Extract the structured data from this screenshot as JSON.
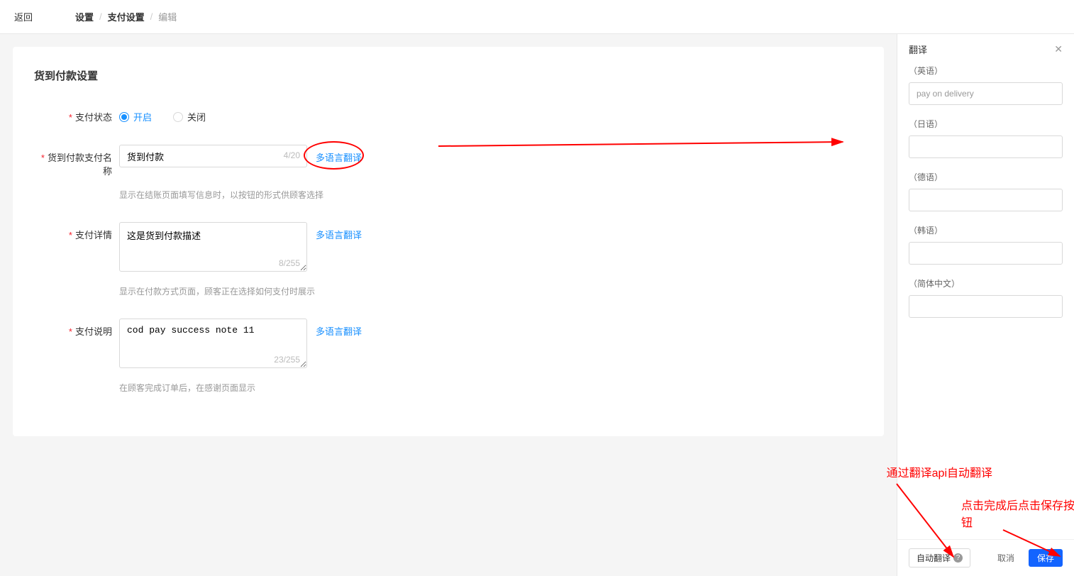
{
  "header": {
    "back": "返回",
    "breadcrumb": [
      "设置",
      "支付设置",
      "编辑"
    ]
  },
  "page": {
    "title": "货到付款设置"
  },
  "form": {
    "status": {
      "label": "支付状态",
      "option_on": "开启",
      "option_off": "关闭"
    },
    "name": {
      "label": "货到付款支付名称",
      "value": "货到付款",
      "count": "4/20",
      "help": "显示在结账页面填写信息时，以按钮的形式供顾客选择"
    },
    "details": {
      "label": "支付详情",
      "value": "这是货到付款描述",
      "count": "8/255",
      "help": "显示在付款方式页面，顾客正在选择如何支付时展示"
    },
    "note": {
      "label": "支付说明",
      "value": "cod pay success note 11",
      "count": "23/255",
      "help": "在顾客完成订单后，在感谢页面显示"
    },
    "translate_link": "多语言翻译"
  },
  "panel": {
    "title": "翻译",
    "languages": [
      {
        "label": "（英语）",
        "value": "pay on delivery"
      },
      {
        "label": "（日语）",
        "value": ""
      },
      {
        "label": "（德语）",
        "value": ""
      },
      {
        "label": "（韩语）",
        "value": ""
      },
      {
        "label": "（简体中文）",
        "value": ""
      }
    ],
    "auto_translate": "自动翻译",
    "cancel": "取消",
    "save": "保存"
  },
  "annotations": {
    "text1": "通过翻译api自动翻译",
    "text2": "点击完成后点击保存按钮"
  }
}
